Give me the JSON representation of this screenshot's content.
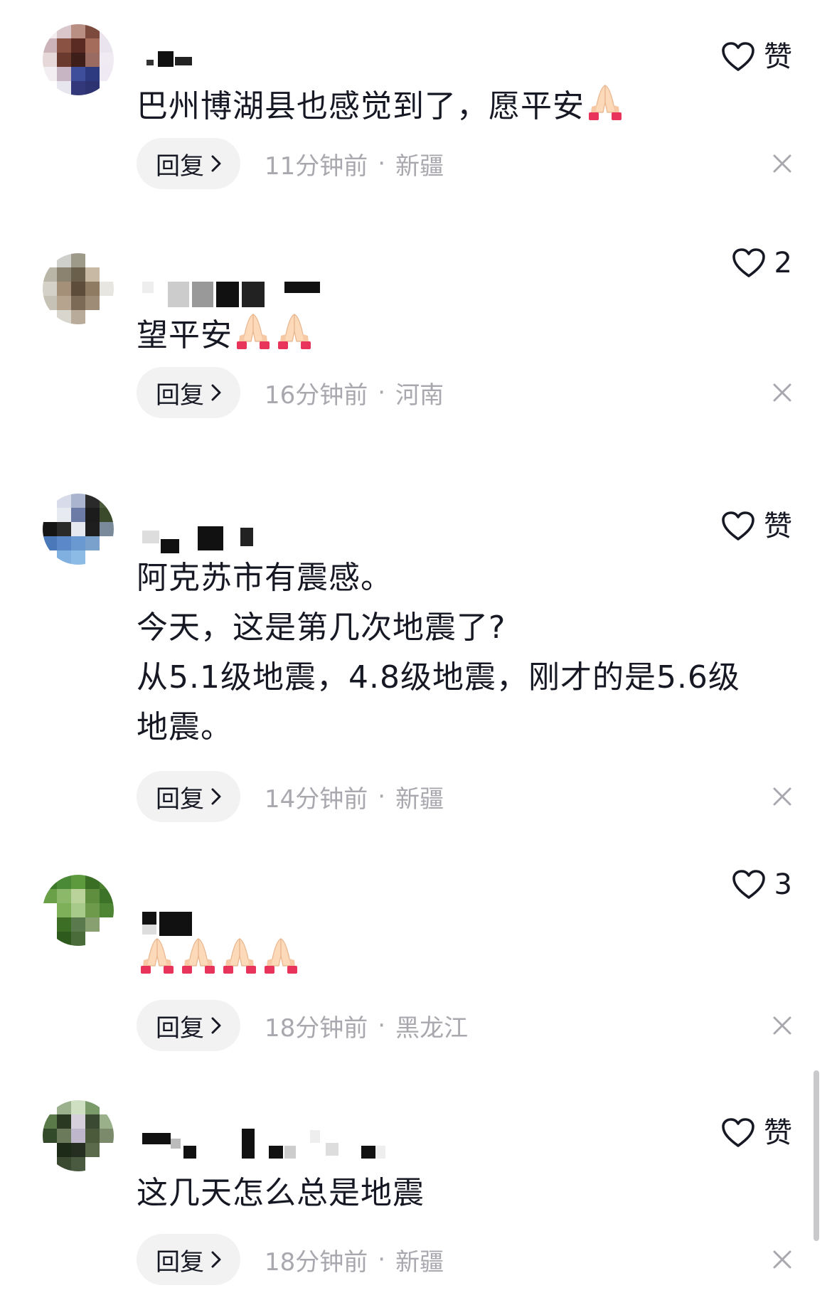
{
  "comments": [
    {
      "like_label": "赞",
      "text": "巴州博湖县也感觉到了，愿平安",
      "emoji_count": 1,
      "reply_label": "回复",
      "time": "11分钟前",
      "location": "新疆"
    },
    {
      "like_label": "2",
      "text": "望平安",
      "emoji_count": 2,
      "reply_label": "回复",
      "time": "16分钟前",
      "location": "河南"
    },
    {
      "like_label": "赞",
      "text": "阿克苏市有震感。\n今天，这是第几次地震了?\n从5.1级地震，4.8级地震，刚才的是5.6级\n地震。",
      "emoji_count": 0,
      "reply_label": "回复",
      "time": "14分钟前",
      "location": "新疆"
    },
    {
      "like_label": "3",
      "text": "",
      "emoji_count": 4,
      "reply_label": "回复",
      "time": "18分钟前",
      "location": "黑龙江"
    },
    {
      "like_label": "赞",
      "text": "这几天怎么总是地震",
      "emoji_count": 0,
      "reply_label": "回复",
      "time": "18分钟前",
      "location": "新疆"
    }
  ],
  "icons": {
    "like": "heart-outline-icon",
    "close": "close-icon",
    "chevron": "chevron-right-icon",
    "emoji": "folded-hands-emoji"
  },
  "colors": {
    "text": "#161823",
    "meta": "#a8a8ae",
    "reply_bg": "#f2f2f3"
  }
}
